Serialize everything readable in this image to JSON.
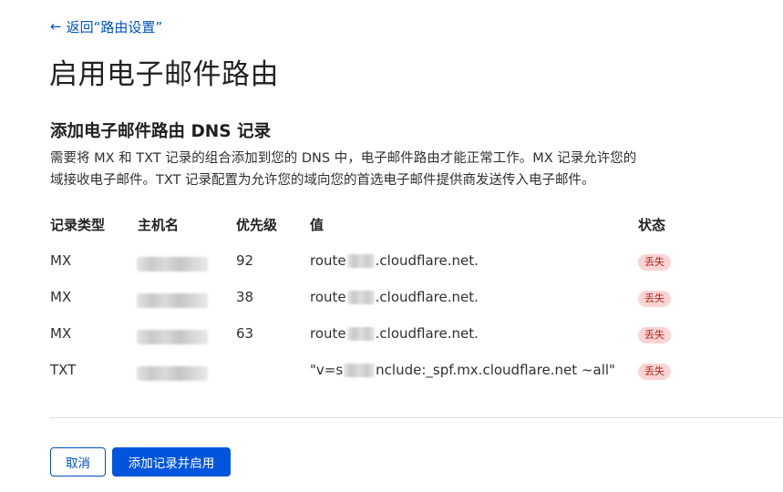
{
  "nav": {
    "back_label": "返回“路由设置”"
  },
  "page": {
    "title": "启用电子邮件路由"
  },
  "section": {
    "title": "添加电子邮件路由 DNS 记录",
    "desc_line1": "需要将 MX 和 TXT 记录的组合添加到您的 DNS 中，电子邮件路由才能正常工作。MX 记录允许您的",
    "desc_line2": "域接收电子邮件。TXT 记录配置为允许您的域向您的首选电子邮件提供商发送传入电子邮件。"
  },
  "table": {
    "headers": {
      "type": "记录类型",
      "host": "主机名",
      "priority": "优先级",
      "value": "值",
      "status": "状态"
    },
    "rows": [
      {
        "type": "MX",
        "priority": "92",
        "value_prefix": "route",
        "value_suffix": ".cloudflare.net.",
        "status": "丢失"
      },
      {
        "type": "MX",
        "priority": "38",
        "value_prefix": "route",
        "value_suffix": ".cloudflare.net.",
        "status": "丢失"
      },
      {
        "type": "MX",
        "priority": "63",
        "value_prefix": "route",
        "value_suffix": ".cloudflare.net.",
        "status": "丢失"
      },
      {
        "type": "TXT",
        "priority": "",
        "value_prefix": "\"v=s",
        "value_suffix": "nclude:_spf.mx.cloudflare.net ~all\"",
        "status": "丢失"
      }
    ]
  },
  "actions": {
    "cancel_label": "取消",
    "submit_label": "添加记录并启用"
  },
  "colors": {
    "link": "#0051c3",
    "primary": "#0055dc",
    "badge_bg": "#fbd4d4",
    "badge_text": "#b3261e"
  },
  "icons": {
    "back": "arrow-left-icon"
  }
}
